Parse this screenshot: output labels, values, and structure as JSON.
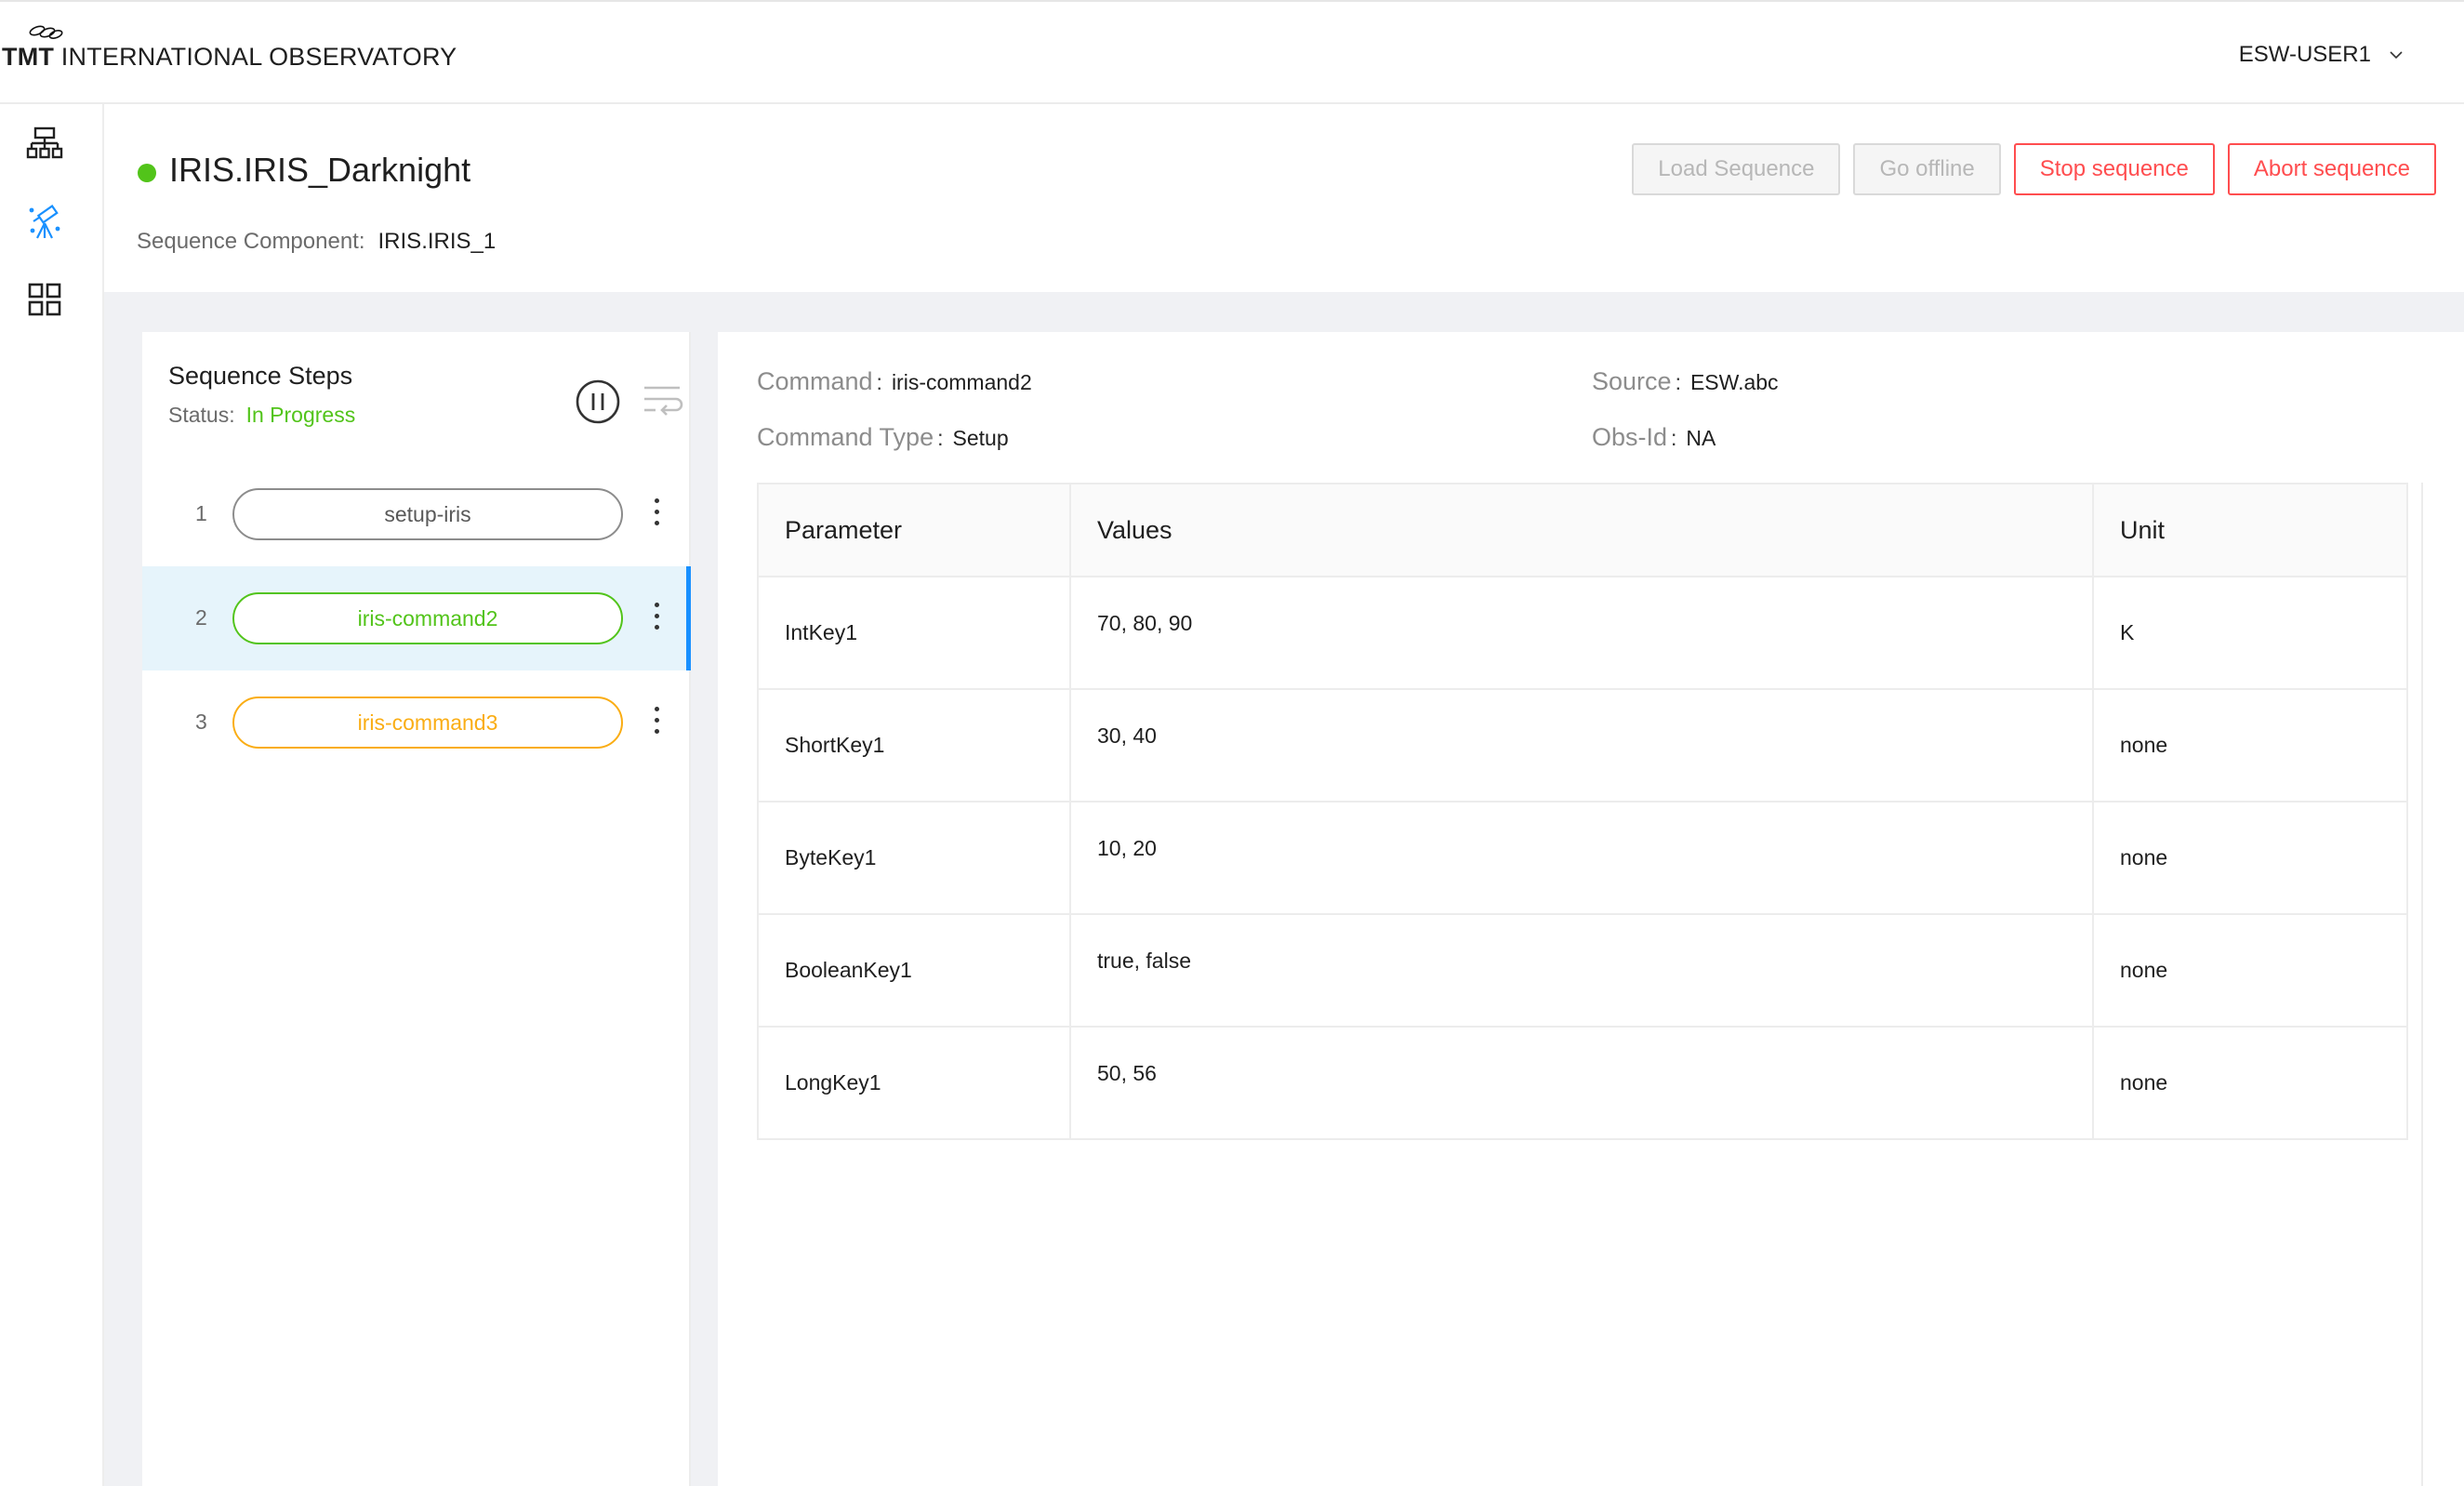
{
  "header": {
    "logo_bold": "TMT",
    "logo_text": "INTERNATIONAL OBSERVATORY",
    "user": "ESW-USER1"
  },
  "nav": {
    "icons": [
      "sitemap-icon",
      "telescope-icon",
      "grid-icon"
    ]
  },
  "sequencer": {
    "name": "IRIS.IRIS_Darknight",
    "status_color": "#52c41a",
    "component_label": "Sequence Component:",
    "component_value": "IRIS.IRIS_1"
  },
  "actions": {
    "load_sequence": "Load Sequence",
    "go_offline": "Go offline",
    "stop_sequence": "Stop sequence",
    "abort_sequence": "Abort sequence"
  },
  "steps": {
    "title": "Sequence Steps",
    "status_label": "Status:",
    "status_value": "In Progress",
    "items": [
      {
        "num": "1",
        "label": "setup-iris"
      },
      {
        "num": "2",
        "label": "iris-command2"
      },
      {
        "num": "3",
        "label": "iris-command3"
      }
    ]
  },
  "details": {
    "command_label": "Command",
    "command_value": "iris-command2",
    "type_label": "Command Type",
    "type_value": "Setup",
    "source_label": "Source",
    "source_value": "ESW.abc",
    "obsid_label": "Obs-Id",
    "obsid_value": "NA"
  },
  "params": {
    "headers": {
      "parameter": "Parameter",
      "values": "Values",
      "unit": "Unit"
    },
    "rows": [
      {
        "parameter": "IntKey1",
        "values": "70, 80, 90",
        "unit": "K"
      },
      {
        "parameter": "ShortKey1",
        "values": "30, 40",
        "unit": "none"
      },
      {
        "parameter": "ByteKey1",
        "values": "10, 20",
        "unit": "none"
      },
      {
        "parameter": "BooleanKey1",
        "values": "true, false",
        "unit": "none"
      },
      {
        "parameter": "LongKey1",
        "values": "50, 56",
        "unit": "none"
      }
    ]
  }
}
